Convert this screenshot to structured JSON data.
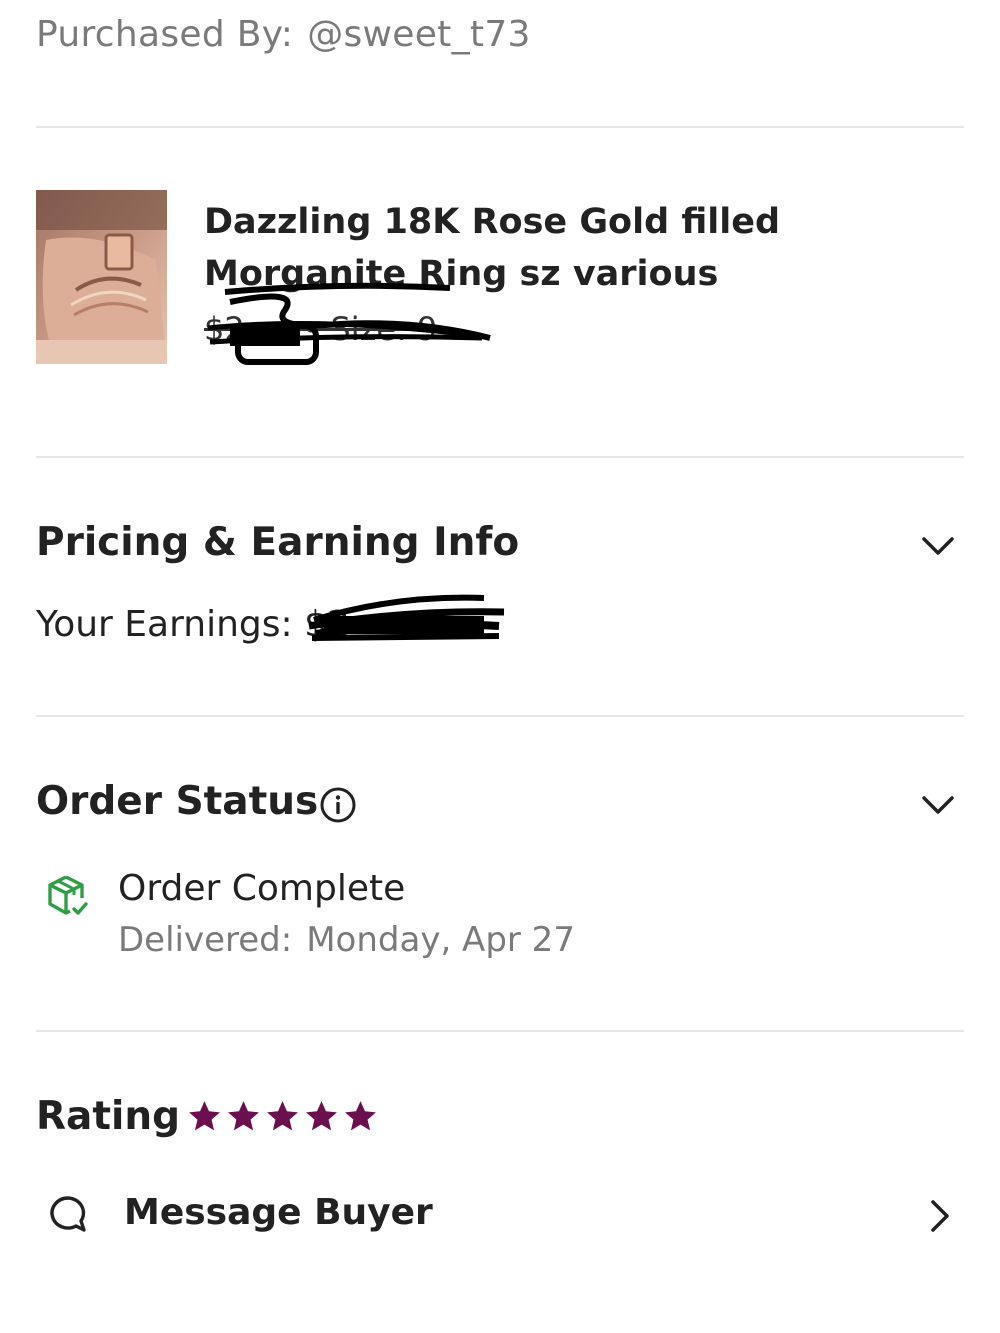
{
  "purchased": {
    "label": "Purchased By:",
    "username": "@sweet_t73"
  },
  "product": {
    "image_alt": "rose gold ring on finger",
    "title": "Dazzling 18K Rose Gold filled Morganite Ring sz various",
    "meta": "$2•••• Size: 9"
  },
  "pricing": {
    "title": "Pricing & Earning Info",
    "earnings_label": "Your Earnings:",
    "earnings_value": "$2•••"
  },
  "order_status": {
    "title": "Order Status",
    "status": "Order Complete",
    "delivered_label": "Delivered:",
    "delivered_date": "Monday, Apr 27"
  },
  "rating": {
    "label": "Rating",
    "stars": 5,
    "star_color": "#6b0f4f"
  },
  "message": {
    "label": "Message Buyer"
  },
  "colors": {
    "accent_green": "#2f9e44",
    "star": "#6b0f4f",
    "divider": "#e6e6e6"
  },
  "icons": {
    "info": "info-circle-icon",
    "chevron_down": "chevron-down-icon",
    "chevron_right": "chevron-right-icon",
    "box": "package-check-icon",
    "message": "chat-bubble-icon",
    "star": "star-icon"
  }
}
